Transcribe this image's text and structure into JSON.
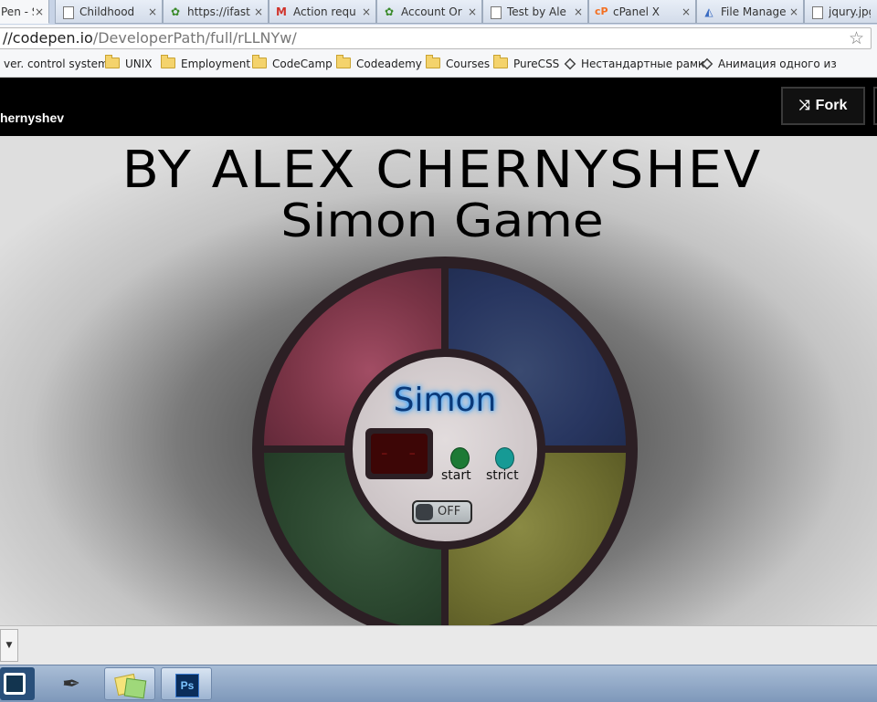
{
  "browser": {
    "tabs": [
      {
        "label": "Pen - S",
        "icon": "codepen-icon",
        "active": true
      },
      {
        "label": "Childhood",
        "icon": "document-icon"
      },
      {
        "label": "https://ifast",
        "icon": "leaf-icon"
      },
      {
        "label": "Action requ",
        "icon": "gmail-icon"
      },
      {
        "label": "Account Or",
        "icon": "leaf-icon"
      },
      {
        "label": "Test by Ale",
        "icon": "document-icon"
      },
      {
        "label": "cPanel X",
        "icon": "cpanel-icon"
      },
      {
        "label": "File Manage",
        "icon": "file-manager-icon"
      },
      {
        "label": "jqury.jpg (",
        "icon": "document-icon"
      }
    ],
    "tab_close_glyph": "×",
    "url_host": "//codepen.io",
    "url_path": "/DeveloperPath/full/rLLNYw/"
  },
  "bookmarks": [
    {
      "label": "ver. control system",
      "icon": "none"
    },
    {
      "label": "UNIX",
      "icon": "folder-icon"
    },
    {
      "label": "Employment",
      "icon": "folder-icon"
    },
    {
      "label": "CodeCamp",
      "icon": "folder-icon"
    },
    {
      "label": "Codeademy",
      "icon": "folder-icon"
    },
    {
      "label": "Courses",
      "icon": "folder-icon"
    },
    {
      "label": "PureCSS",
      "icon": "folder-icon"
    },
    {
      "label": "Нестандартные рамк",
      "icon": "codepen-icon"
    },
    {
      "label": "Анимация одного из",
      "icon": "codepen-icon"
    }
  ],
  "codepen": {
    "author": "hernyshev",
    "fork_label": "Fork"
  },
  "game": {
    "title_line1": "BY ALEX CHERNYSHEV",
    "title_line2": "Simon Game",
    "logo": "Simon",
    "counter_display": "- -",
    "start_label": "start",
    "strict_label": "strict",
    "power_label": "OFF",
    "power_on": false,
    "colors": {
      "red": "#7a3446",
      "blue": "#283660",
      "green": "#2b472f",
      "yellow": "#6e6e30",
      "start": "#1d7a35",
      "strict": "#169a95"
    }
  },
  "taskbar": {
    "items": [
      "start-icon",
      "pen-tool-icon",
      "sticky-notes-icon",
      "photoshop-icon"
    ],
    "ps_label": "Ps"
  }
}
